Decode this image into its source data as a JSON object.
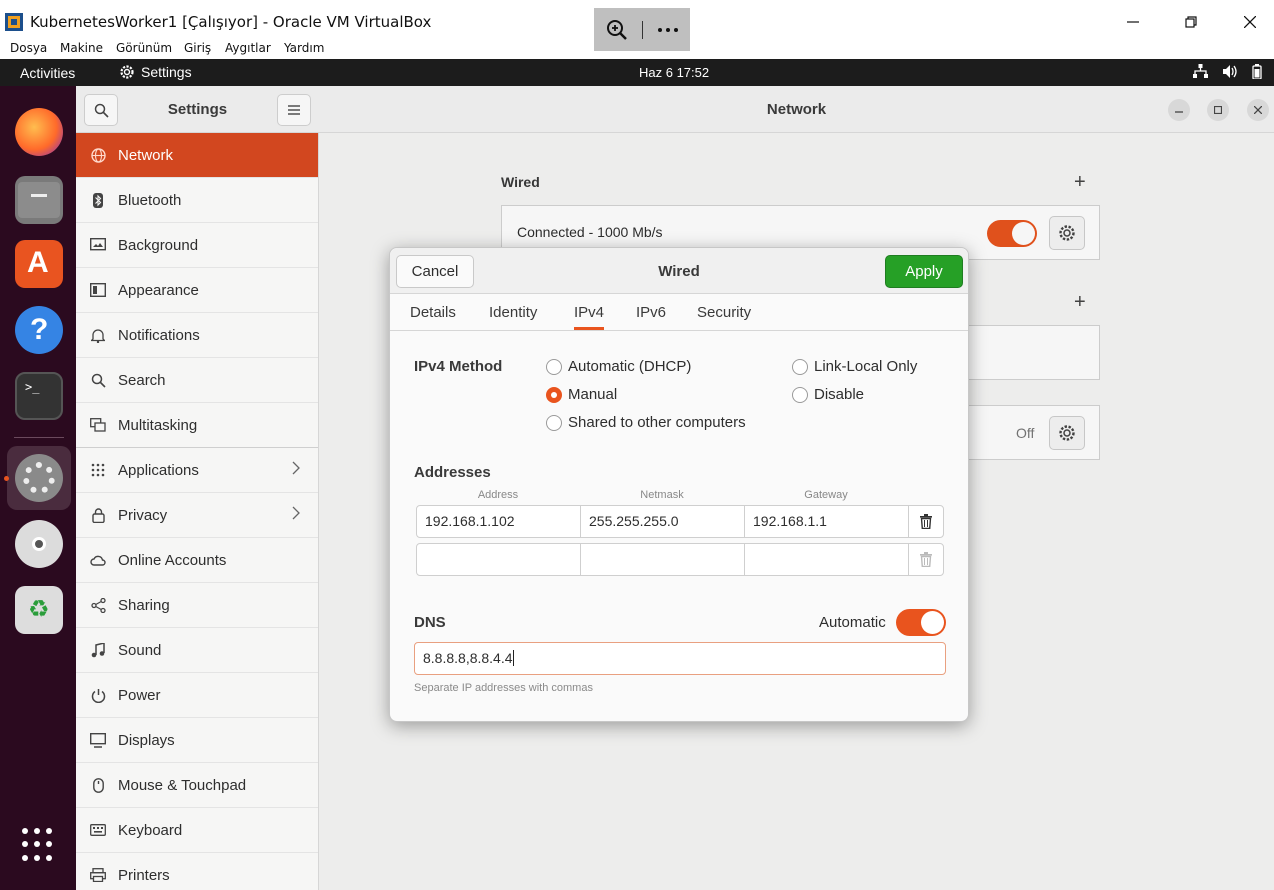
{
  "window": {
    "title": "KubernetesWorker1 [Çalışıyor] - Oracle VM VirtualBox",
    "menu": [
      "Dosya",
      "Makine",
      "Görünüm",
      "Giriş",
      "Aygıtlar",
      "Yardım"
    ],
    "minimize_icon": "minimize-icon",
    "maximize_icon": "maximize-icon",
    "close_icon": "close-icon"
  },
  "topbar": {
    "activities": "Activities",
    "app_name": "Settings",
    "clock": "Haz 6  17:52"
  },
  "settings": {
    "sidebar_title": "Settings",
    "items": [
      {
        "label": "Network",
        "icon": "globe-icon",
        "selected": true
      },
      {
        "label": "Bluetooth",
        "icon": "bluetooth-icon"
      },
      {
        "label": "Background",
        "icon": "background-icon"
      },
      {
        "label": "Appearance",
        "icon": "appearance-icon"
      },
      {
        "label": "Notifications",
        "icon": "bell-icon"
      },
      {
        "label": "Search",
        "icon": "search-icon"
      },
      {
        "label": "Multitasking",
        "icon": "multitasking-icon"
      },
      {
        "label": "Applications",
        "icon": "apps-grid-icon",
        "chevron": true
      },
      {
        "label": "Privacy",
        "icon": "lock-icon",
        "chevron": true
      },
      {
        "label": "Online Accounts",
        "icon": "cloud-icon"
      },
      {
        "label": "Sharing",
        "icon": "share-icon"
      },
      {
        "label": "Sound",
        "icon": "music-note-icon"
      },
      {
        "label": "Power",
        "icon": "power-icon"
      },
      {
        "label": "Displays",
        "icon": "display-icon"
      },
      {
        "label": "Mouse & Touchpad",
        "icon": "mouse-icon"
      },
      {
        "label": "Keyboard",
        "icon": "keyboard-icon"
      },
      {
        "label": "Printers",
        "icon": "printer-icon"
      }
    ]
  },
  "network": {
    "title": "Network",
    "wired_label": "Wired",
    "connection_status": "Connected - 1000 Mb/s",
    "connection_on": true,
    "vpn_state": "Off"
  },
  "dialog": {
    "title": "Wired",
    "cancel": "Cancel",
    "apply": "Apply",
    "tabs": [
      "Details",
      "Identity",
      "IPv4",
      "IPv6",
      "Security"
    ],
    "active_tab": "IPv4",
    "ipv4_method_label": "IPv4 Method",
    "methods": {
      "automatic": "Automatic (DHCP)",
      "manual": "Manual",
      "shared": "Shared to other computers",
      "link_local": "Link-Local Only",
      "disable": "Disable"
    },
    "selected_method": "Manual",
    "addresses_label": "Addresses",
    "columns": [
      "Address",
      "Netmask",
      "Gateway"
    ],
    "rows": [
      [
        "192.168.1.102",
        "255.255.255.0",
        "192.168.1.1"
      ],
      [
        "",
        "",
        ""
      ]
    ],
    "dns_label": "DNS",
    "dns_automatic_label": "Automatic",
    "dns_automatic_on": true,
    "dns_value": "8.8.8.8,8.8.4.4",
    "dns_hint": "Separate IP addresses with commas"
  },
  "colors": {
    "accent": "#e9541e",
    "apply_green": "#26a026",
    "dock": "#2b0a1f"
  }
}
